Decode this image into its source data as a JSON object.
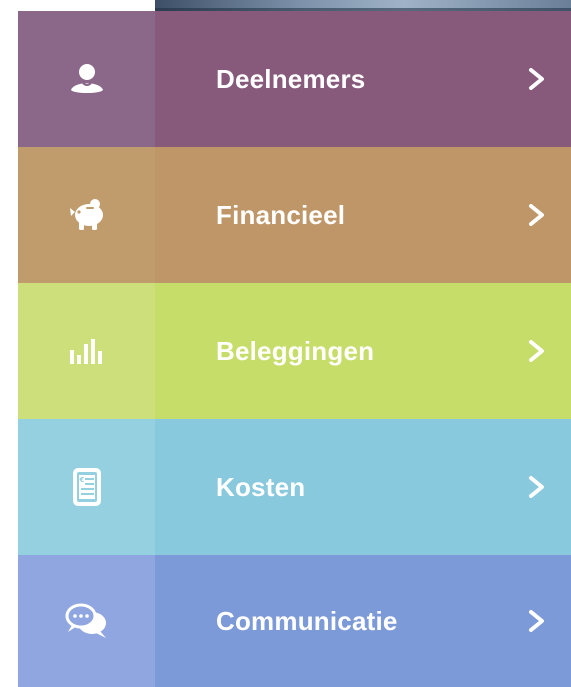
{
  "menu": {
    "items": [
      {
        "label": "Deelnemers",
        "icon": "person-icon",
        "icon_bg": "#8b6789",
        "bg": "#875a7c"
      },
      {
        "label": "Financieel",
        "icon": "piggy-bank-icon",
        "icon_bg": "#c09b6c",
        "bg": "#bf9667"
      },
      {
        "label": "Beleggingen",
        "icon": "bar-chart-icon",
        "icon_bg": "#ccdf7a",
        "bg": "#c7dd6a"
      },
      {
        "label": "Kosten",
        "icon": "invoice-euro-icon",
        "icon_bg": "#95d0e0",
        "bg": "#88c9dd"
      },
      {
        "label": "Communicatie",
        "icon": "chat-bubbles-icon",
        "icon_bg": "#90a6e0",
        "bg": "#7d9ad8"
      }
    ]
  }
}
